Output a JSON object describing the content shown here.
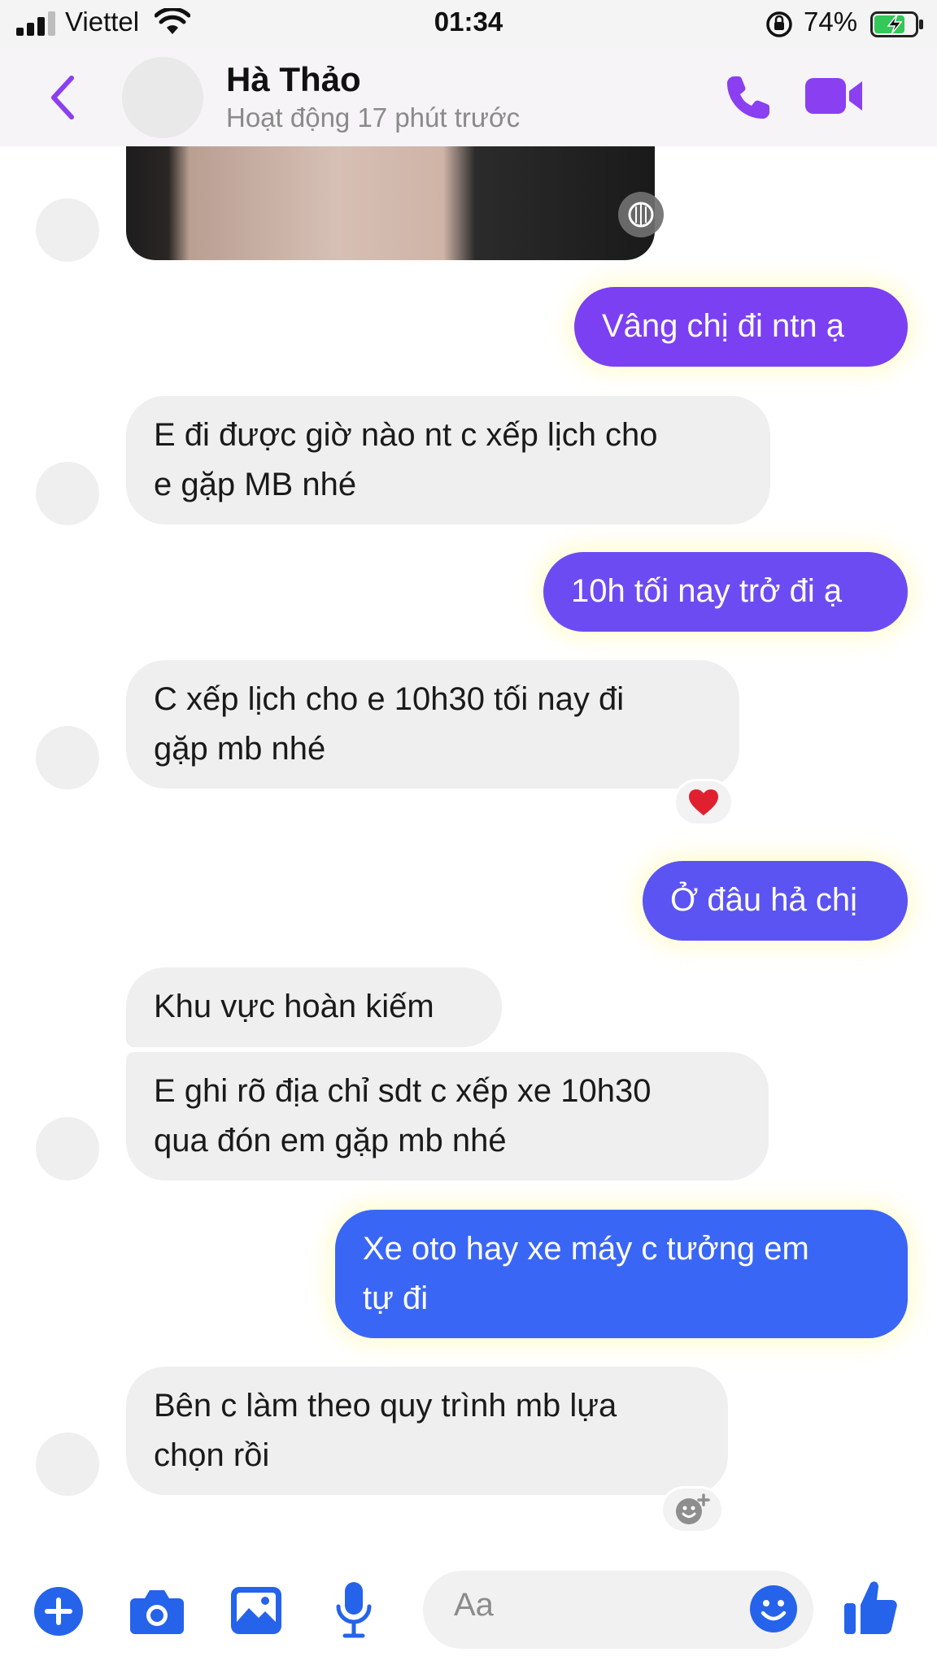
{
  "status_bar": {
    "carrier": "Viettel",
    "time": "01:34",
    "battery": "74%",
    "battery_level": 0.74,
    "icons": [
      "signal-icon",
      "wifi-icon",
      "rotation-lock-icon",
      "battery-charging-icon"
    ]
  },
  "header": {
    "name": "Hà Thảo",
    "status": "Hoạt động 17 phút trước",
    "icons": [
      "back-chevron-icon",
      "phone-icon",
      "video-camera-icon"
    ]
  },
  "colors": {
    "accent": "#8a3ff0",
    "outgoing_top": "#8a36f0",
    "outgoing_bottom": "#2f6cf7",
    "incoming": "#efefef",
    "composer_icons": "#2563eb"
  },
  "messages": [
    {
      "side": "out",
      "lines": [
        "Vâng chị đi ntn ạ"
      ]
    },
    {
      "side": "in",
      "lines": [
        "E đi được giờ nào nt c xếp lịch cho",
        "e gặp MB nhé"
      ]
    },
    {
      "side": "out",
      "lines": [
        "10h tối nay trở đi ạ"
      ]
    },
    {
      "side": "in",
      "lines": [
        "C xếp lịch cho e 10h30 tối nay đi",
        "gặp mb nhé"
      ],
      "reaction": "heart"
    },
    {
      "side": "out",
      "lines": [
        "Ở đâu hả chị"
      ]
    },
    {
      "side": "in",
      "lines": [
        "Khu vực hoàn kiếm"
      ]
    },
    {
      "side": "in",
      "lines": [
        "E ghi rõ địa chỉ sdt c xếp xe 10h30",
        "qua đón em gặp mb nhé"
      ]
    },
    {
      "side": "out",
      "lines": [
        "Xe oto hay xe máy c tưởng em",
        "tự đi"
      ]
    },
    {
      "side": "in",
      "lines": [
        "Bên c làm theo quy trình mb lựa",
        "chọn rồi"
      ],
      "reaction": "add-reaction"
    }
  ],
  "composer": {
    "placeholder": "Aa",
    "icons": [
      "plus-icon",
      "camera-icon",
      "image-icon",
      "microphone-icon",
      "emoji-icon",
      "thumbs-up-icon"
    ]
  }
}
